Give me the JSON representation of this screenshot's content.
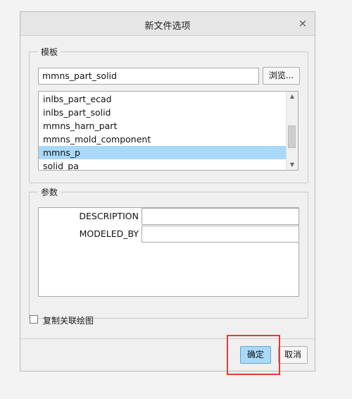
{
  "dialog": {
    "title": "新文件选项",
    "close_glyph": "×"
  },
  "template_group": {
    "label": "模板",
    "input_value": "mmns_part_solid",
    "browse_label": "浏览...",
    "list_items": [
      {
        "label": "inlbs_part_ecad",
        "selected": false
      },
      {
        "label": "inlbs_part_solid",
        "selected": false
      },
      {
        "label": "mmns_harn_part",
        "selected": false
      },
      {
        "label": "mmns_mold_component",
        "selected": false
      },
      {
        "label": "mmns_p",
        "selected": true
      },
      {
        "label": "solid_pa",
        "selected": false
      }
    ],
    "scroll_up_glyph": "▲",
    "scroll_down_glyph": "▼"
  },
  "parameters_group": {
    "label": "参数",
    "rows": [
      {
        "name": "DESCRIPTION",
        "value": ""
      },
      {
        "name": "MODELED_BY",
        "value": ""
      }
    ]
  },
  "copy_drawing_checkbox": {
    "label": "复制关联绘图",
    "checked": false
  },
  "footer": {
    "ok_label": "确定",
    "cancel_label": "取消"
  },
  "colors": {
    "selected_row": "#a9d9f7",
    "ok_button": "#a9d9f7",
    "highlight_box": "#e53935"
  },
  "icons": {
    "close": "close-icon",
    "scroll_up": "chevron-up-icon",
    "scroll_down": "chevron-down-icon"
  }
}
